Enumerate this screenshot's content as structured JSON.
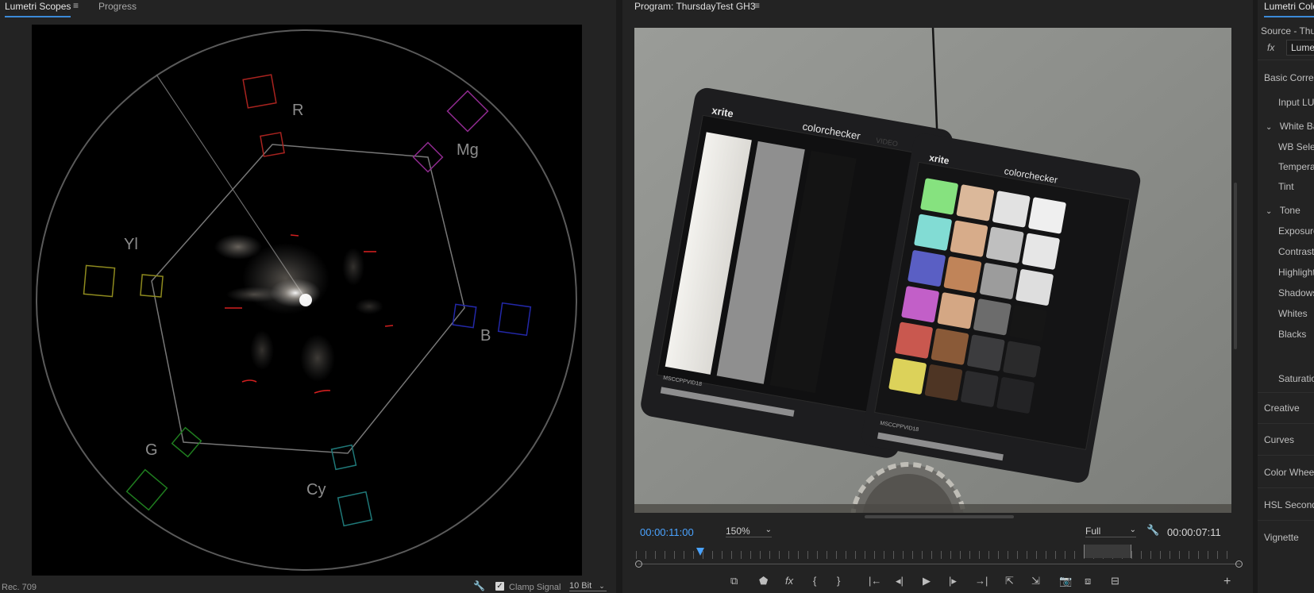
{
  "scopes_panel": {
    "tabs": [
      {
        "label": "Lumetri Scopes"
      },
      {
        "label": "Progress"
      }
    ],
    "vectorscope_labels": {
      "r": "R",
      "mg": "Mg",
      "yl": "Yl",
      "b": "B",
      "g": "G",
      "cy": "Cy"
    },
    "footer": {
      "colorspace": "Rec. 709",
      "clamp_label": "Clamp Signal",
      "clamp_checked": true,
      "bit_depth": "10 Bit"
    }
  },
  "program_panel": {
    "title": "Program: ThursdayTest GH3",
    "timecode_current": "00:00:11:00",
    "zoom": "150%",
    "resolution": "Full",
    "timecode_duration": "00:00:07:11",
    "card_brand": "xrite",
    "card_name": "colorchecker",
    "card_badge": "VIDEO",
    "card_serial": "MSCCPPVID18"
  },
  "lumetri_panel": {
    "title": "Lumetri Colo",
    "source": "Source - Thur",
    "fx_value": "Lumet",
    "items": {
      "basic_correction": "Basic Correc",
      "input_lut": "Input LUT",
      "white_balance": "White Ba",
      "wb_selector": "WB Selec",
      "temperature": "Tempera",
      "tint": "Tint",
      "tone": "Tone",
      "exposure": "Exposure",
      "contrast": "Contrast",
      "highlights": "Highlight",
      "shadows": "Shadows",
      "whites": "Whites",
      "blacks": "Blacks",
      "saturation": "Saturatio",
      "creative": "Creative",
      "curves": "Curves",
      "color_wheels": "Color Wheel",
      "hsl_secondary": "HSL Second",
      "vignette": "Vignette"
    }
  },
  "colors": {
    "accent": "#3b8ad8",
    "timecode": "#4aa3ff",
    "panel_bg": "#232323",
    "scope_bg": "#000000"
  }
}
